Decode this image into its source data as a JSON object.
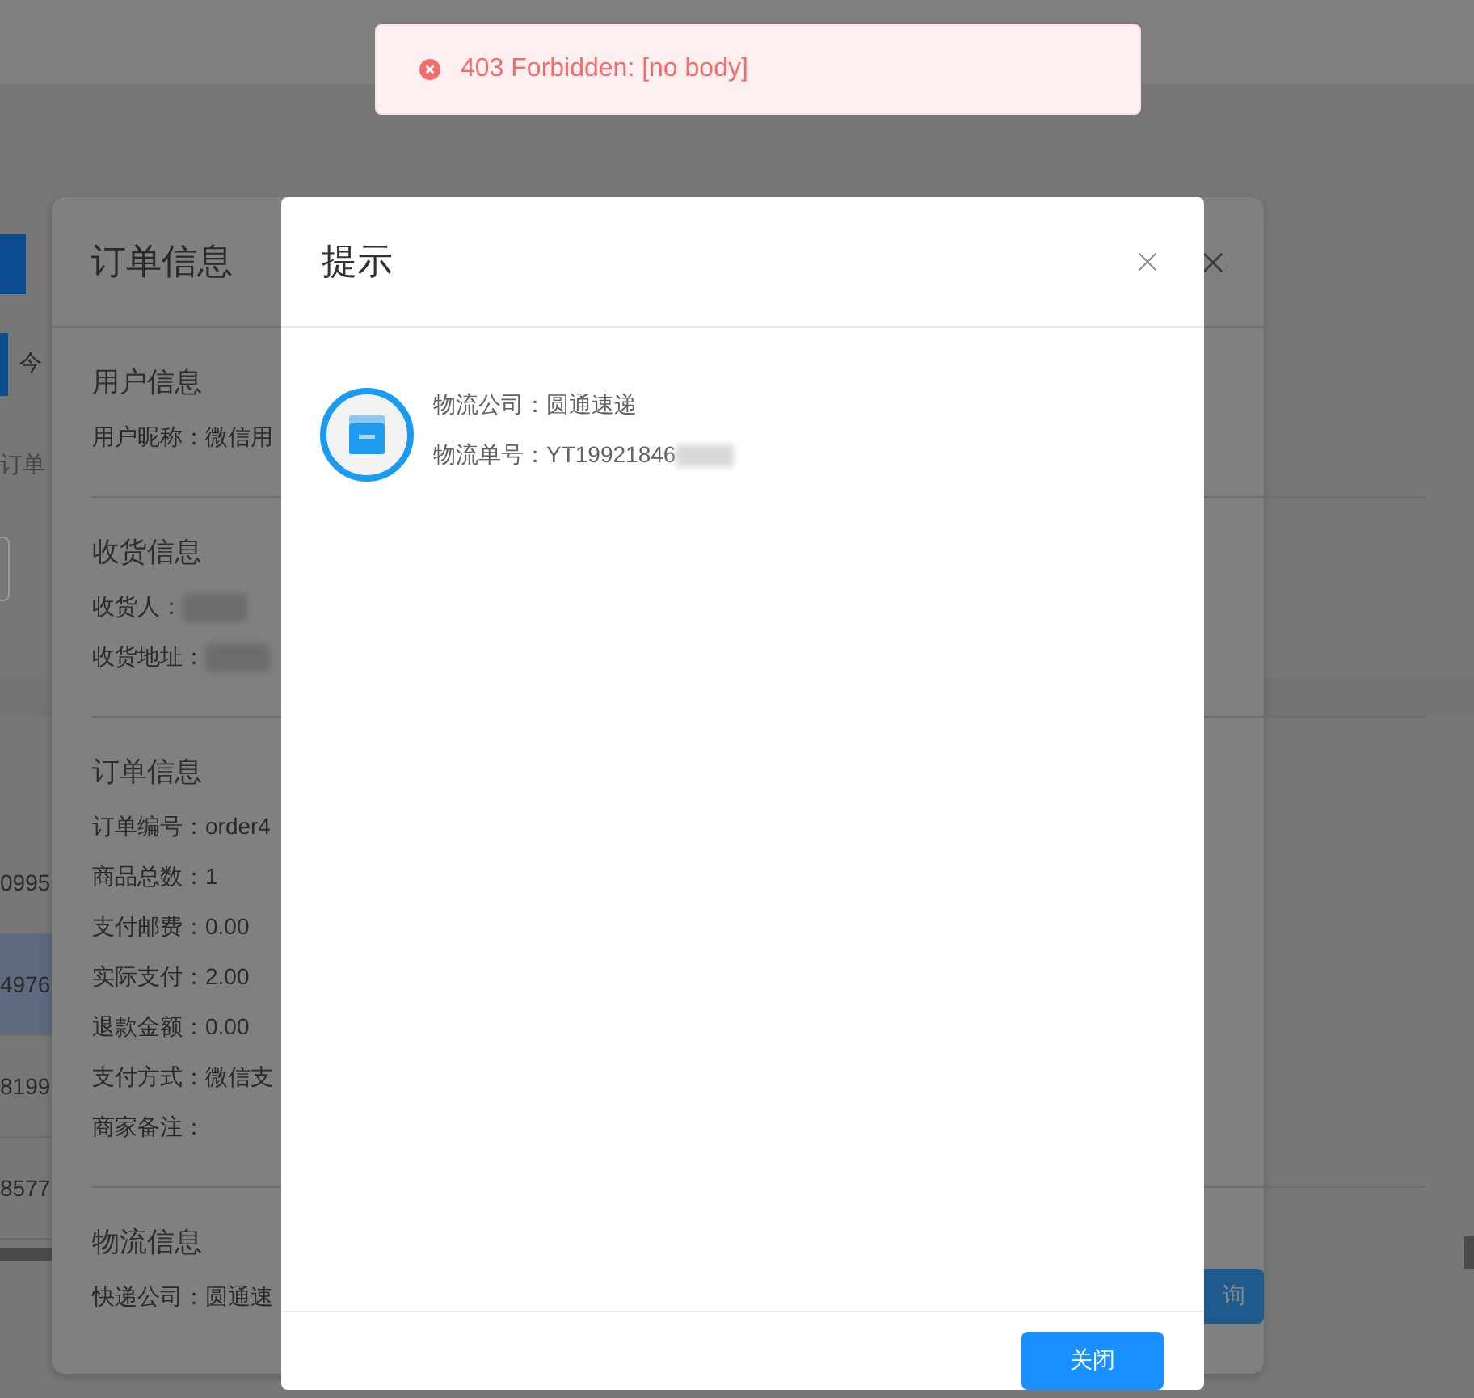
{
  "background": {
    "tab_fragment": "今",
    "search_placeholder_fragment": "订单",
    "table_rows": [
      {
        "cell": "0995",
        "selected": false
      },
      {
        "cell": "4976",
        "selected": true
      },
      {
        "cell": "8199",
        "selected": false
      },
      {
        "cell": "8577",
        "selected": false
      }
    ],
    "button_fragment": "询"
  },
  "order_dialog": {
    "title": "订单信息",
    "sections": [
      {
        "heading": "用户信息",
        "rows": [
          {
            "label": "用户昵称：",
            "value": "微信用"
          }
        ]
      },
      {
        "heading": "收货信息",
        "rows": [
          {
            "label": "收货人：",
            "redacted": true
          },
          {
            "label": "收货地址：",
            "redacted": true
          }
        ]
      },
      {
        "heading": "订单信息",
        "rows": [
          {
            "label": "订单编号：",
            "value": "order4"
          },
          {
            "label": "商品总数：",
            "value": "1"
          },
          {
            "label": "支付邮费：",
            "value": "0.00"
          },
          {
            "label": "实际支付：",
            "value": "2.00"
          },
          {
            "label": "退款金额：",
            "value": "0.00"
          },
          {
            "label": "支付方式：",
            "value": "微信支"
          },
          {
            "label": "商家备注："
          }
        ]
      },
      {
        "heading": "物流信息",
        "rows": [
          {
            "label": "快递公司：",
            "value": "圆通速"
          }
        ]
      }
    ]
  },
  "prompt_dialog": {
    "title": "提示",
    "lines": [
      {
        "label": "物流公司：",
        "value": "圆通速递"
      },
      {
        "label": "物流单号：",
        "value": "YT19921846",
        "redacted": true
      }
    ],
    "button": "关闭"
  },
  "toast": {
    "message": "403 Forbidden: [no body]"
  }
}
